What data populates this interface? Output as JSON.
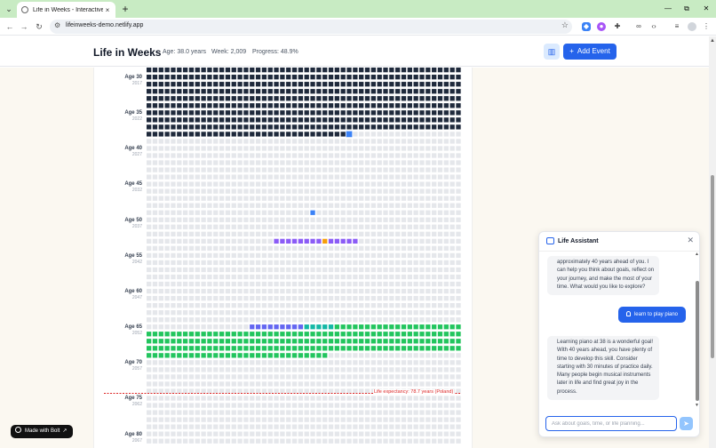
{
  "browser": {
    "tab_title": "Life in Weeks - Interactive Life",
    "tab_close": "×",
    "new_tab": "+",
    "tab_menu": "⌄",
    "url": "lifeinweeks-demo.netlify.app",
    "window": {
      "minimize": "—",
      "maximize": "⧉",
      "close": "✕"
    }
  },
  "header": {
    "title": "Life in Weeks",
    "age": "Age: 38.0 years",
    "week": "Week: 2,009",
    "progress": "Progress: 48.9%",
    "add_event": "Add Event"
  },
  "grid": {
    "columns": 52,
    "current_week_index": 2009,
    "age_labels": [
      {
        "age": "Age 30",
        "year": "2017"
      },
      {
        "age": "Age 35",
        "year": "2022"
      },
      {
        "age": "Age 40",
        "year": "2027"
      },
      {
        "age": "Age 45",
        "year": "2032"
      },
      {
        "age": "Age 50",
        "year": "2037"
      },
      {
        "age": "Age 55",
        "year": "2042"
      },
      {
        "age": "Age 60",
        "year": "2047"
      },
      {
        "age": "Age 65",
        "year": "2052"
      },
      {
        "age": "Age 70",
        "year": "2057"
      },
      {
        "age": "Age 75",
        "year": "2062"
      },
      {
        "age": "Age 80",
        "year": "2067"
      }
    ],
    "life_expectancy_label": "Life expectancy: 78.7 years (Poland)",
    "colors": {
      "lived": "#1f2a3c",
      "future": "#e5e7eb",
      "current": "#3b82f6",
      "event_purple": "#8b5cf6",
      "event_indigo": "#6366f1",
      "event_green": "#22c55e",
      "event_orange": "#f59e0b",
      "event_teal": "#14b8a6",
      "expectancy": "#dc2626"
    }
  },
  "badge": {
    "label": "Made with Bolt"
  },
  "assistant": {
    "title": "Life Assistant",
    "messages": [
      {
        "role": "assistant",
        "text": "approximately 40 years ahead of you. I can help you think about goals, reflect on your journey, and make the most of your time. What would you like to explore?"
      },
      {
        "role": "user",
        "text": "learn to play piano"
      },
      {
        "role": "assistant",
        "text": "Learning piano at 38 is a wonderful goal! With 40 years ahead, you have plenty of time to develop this skill. Consider starting with 30 minutes of practice daily. Many people begin musical instruments later in life and find great joy in the process."
      }
    ],
    "input_placeholder": "Ask about goals, time, or life planning...",
    "input_value": ""
  }
}
